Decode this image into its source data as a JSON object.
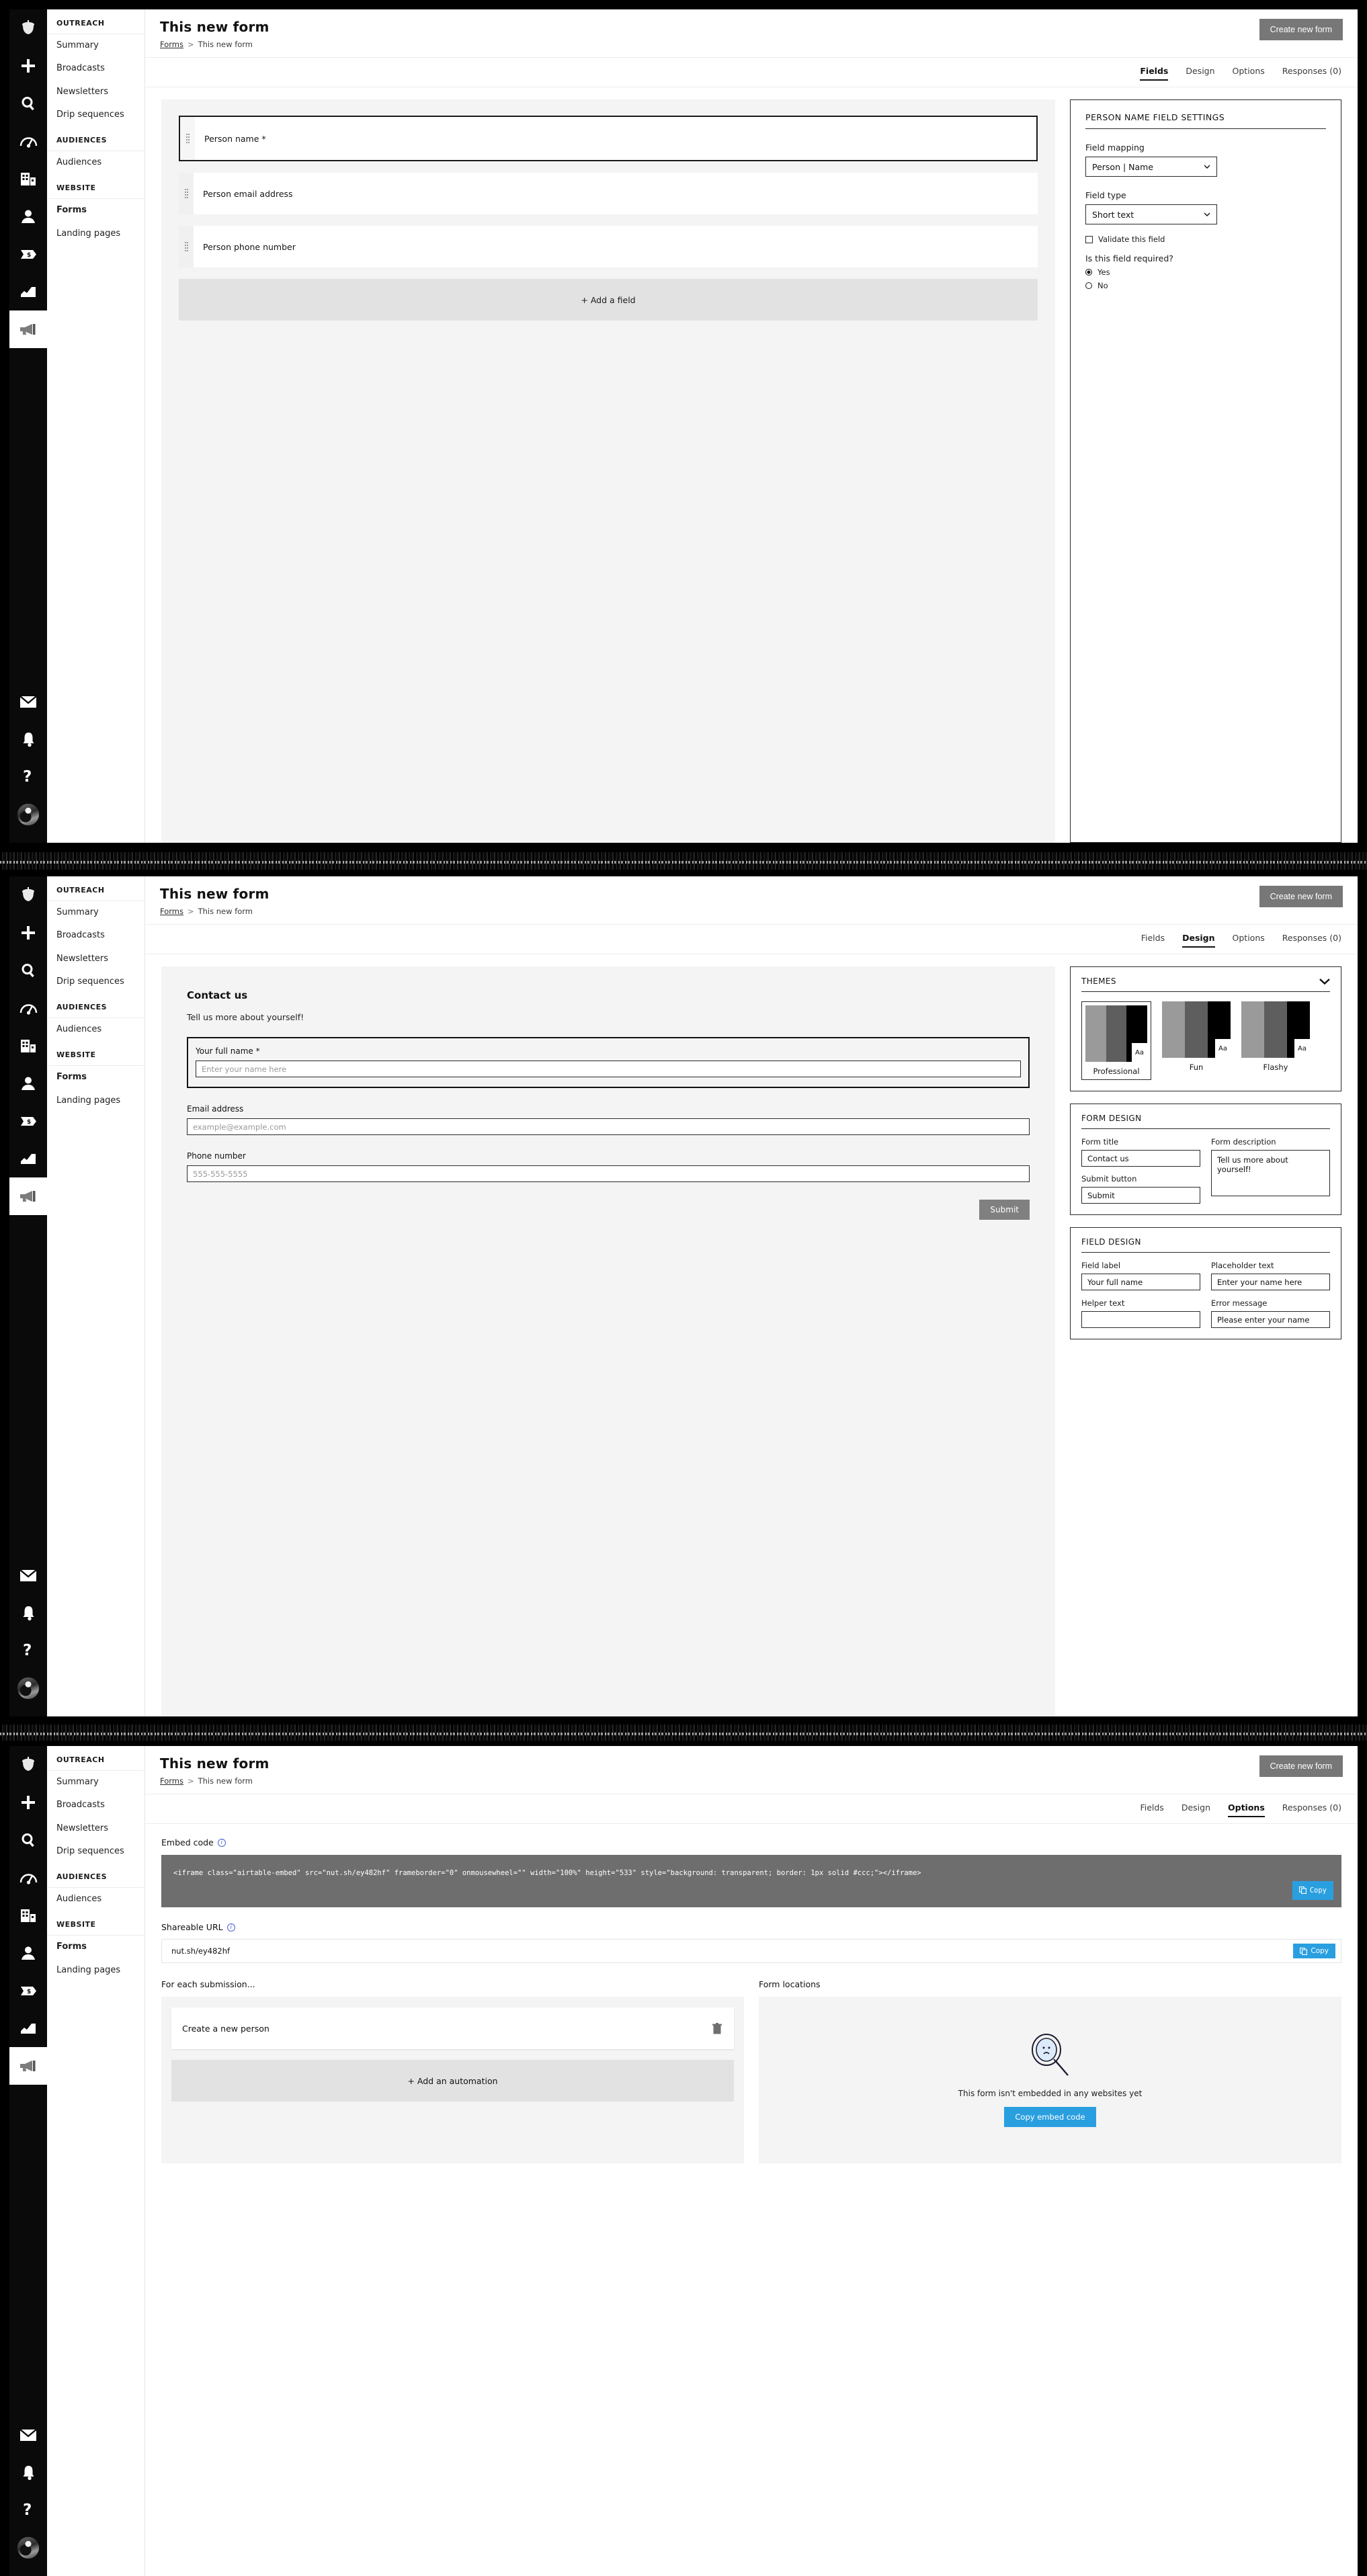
{
  "rail": {
    "top_icons": [
      "acorn-logo-icon",
      "plus-icon",
      "search-icon",
      "gauge-icon",
      "company-icon",
      "person-icon",
      "deal-icon",
      "reports-icon",
      "megaphone-icon"
    ],
    "bottom_icons": [
      "mail-icon",
      "bell-icon",
      "help-icon",
      "avatar"
    ]
  },
  "sidebar": {
    "groups": [
      {
        "title": "OUTREACH",
        "items": [
          {
            "label": "Summary",
            "active": false
          },
          {
            "label": "Broadcasts",
            "active": false
          },
          {
            "label": "Newsletters",
            "active": false
          },
          {
            "label": "Drip sequences",
            "active": false
          }
        ]
      },
      {
        "title": "AUDIENCES",
        "items": [
          {
            "label": "Audiences",
            "active": false
          }
        ]
      },
      {
        "title": "WEBSITE",
        "items": [
          {
            "label": "Forms",
            "active": true
          },
          {
            "label": "Landing pages",
            "active": false
          }
        ]
      }
    ]
  },
  "header": {
    "title": "This new form",
    "breadcrumb_root": "Forms",
    "breadcrumb_sep": ">",
    "breadcrumb_current": "This new form",
    "create_button": "Create new form"
  },
  "tabs": [
    {
      "label": "Fields"
    },
    {
      "label": "Design"
    },
    {
      "label": "Options"
    },
    {
      "label": "Responses (0)"
    }
  ],
  "panel_fields": {
    "active_tab": "Fields",
    "rows": [
      {
        "label": "Person name *",
        "selected": true
      },
      {
        "label": "Person email address",
        "selected": false
      },
      {
        "label": "Person phone number",
        "selected": false
      }
    ],
    "add_field": "+ Add a field",
    "settings": {
      "title": "PERSON NAME FIELD SETTINGS",
      "field_mapping_label": "Field mapping",
      "field_mapping_value": "Person | Name",
      "field_type_label": "Field type",
      "field_type_value": "Short text",
      "validate_label": "Validate this field",
      "validate_checked": false,
      "required_label": "Is this field required?",
      "required_yes": "Yes",
      "required_no": "No",
      "required_value": "Yes"
    }
  },
  "panel_design": {
    "active_tab": "Design",
    "preview": {
      "title": "Contact us",
      "description": "Tell us more about yourself!",
      "fields": [
        {
          "label": "Your full name *",
          "placeholder": "Enter your name here",
          "selected": true
        },
        {
          "label": "Email address",
          "placeholder": "example@example.com",
          "selected": false
        },
        {
          "label": "Phone number",
          "placeholder": "555-555-5555",
          "selected": false
        }
      ],
      "submit": "Submit"
    },
    "themes": {
      "title": "THEMES",
      "items": [
        {
          "name": "Professional",
          "selected": true,
          "colors": [
            "#9a9a9a",
            "#5e5e5e",
            "#000000"
          ],
          "sample": "Aa"
        },
        {
          "name": "Fun",
          "selected": false,
          "colors": [
            "#9a9a9a",
            "#5e5e5e",
            "#000000"
          ],
          "sample": "Aa"
        },
        {
          "name": "Flashy",
          "selected": false,
          "colors": [
            "#9a9a9a",
            "#5e5e5e",
            "#000000"
          ],
          "sample": "Aa"
        }
      ]
    },
    "form_design": {
      "title": "FORM DESIGN",
      "form_title_label": "Form title",
      "form_title_value": "Contact us",
      "submit_label": "Submit button",
      "submit_value": "Submit",
      "description_label": "Form description",
      "description_value": "Tell us more about yourself!"
    },
    "field_design": {
      "title": "FIELD DESIGN",
      "field_label_label": "Field label",
      "field_label_value": "Your full name",
      "placeholder_label": "Placeholder text",
      "placeholder_value": "Enter your name here",
      "helper_label": "Helper text",
      "helper_value": "",
      "error_label": "Error message",
      "error_value": "Please enter your name"
    }
  },
  "panel_options": {
    "active_tab": "Options",
    "embed_label": "Embed code",
    "embed_code": "<iframe class=\"airtable-embed\" src=\"nut.sh/ey482hf\" frameborder=\"0\" onmousewheel=\"\" width=\"100%\" height=\"533\" style=\"background: transparent; border: 1px solid #ccc;\"></iframe>",
    "copy_label": "Copy",
    "url_label": "Shareable URL",
    "url_value": "nut.sh/ey482hf",
    "submission_title": "For each submission...",
    "automation_name": "Create a new person",
    "add_automation": "+ Add an automation",
    "locations_title": "Form locations",
    "empty_text": "This form isn't embedded in any websites yet",
    "empty_button": "Copy embed code"
  },
  "colors": {
    "accent_blue": "#2a9fe0",
    "grey_button": "#777777",
    "code_bg": "#6e6e6e"
  }
}
